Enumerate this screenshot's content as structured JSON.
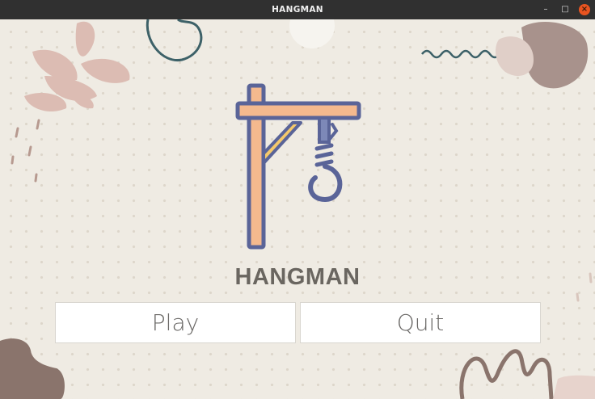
{
  "window": {
    "title": "HANGMAN",
    "controls": {
      "minimize": "–",
      "maximize": "□",
      "close": "×"
    }
  },
  "app": {
    "title": "HANGMAN",
    "buttons": {
      "play": "Play",
      "quit": "Quit"
    }
  },
  "colors": {
    "background": "#efebe3",
    "gallows_outline": "#5a6498",
    "gallows_fill": "#f4b98e",
    "gallows_brace": "#f5c96b",
    "close_button": "#e95420"
  }
}
